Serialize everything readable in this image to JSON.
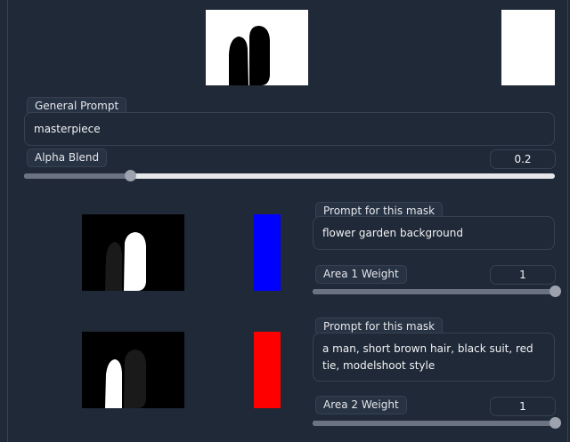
{
  "general": {
    "label": "General Prompt",
    "value": "masterpiece"
  },
  "alpha": {
    "label": "Alpha Blend",
    "value": "0.2",
    "fraction": 0.2
  },
  "areas": [
    {
      "prompt_label": "Prompt for this mask",
      "prompt_value": "flower garden background",
      "weight_label": "Area 1 Weight",
      "weight_value": "1",
      "weight_fraction": 1.0,
      "color": "#0000ff"
    },
    {
      "prompt_label": "Prompt for this mask",
      "prompt_value": "a man, short brown hair, black suit, red tie, modelshoot style",
      "weight_label": "Area 2 Weight",
      "weight_value": "1",
      "weight_fraction": 1.0,
      "color": "#ff0000"
    }
  ],
  "colors": {
    "background": "#1f2937",
    "border": "#374151",
    "track": "#e5e7eb",
    "fill": "#6b7280"
  }
}
